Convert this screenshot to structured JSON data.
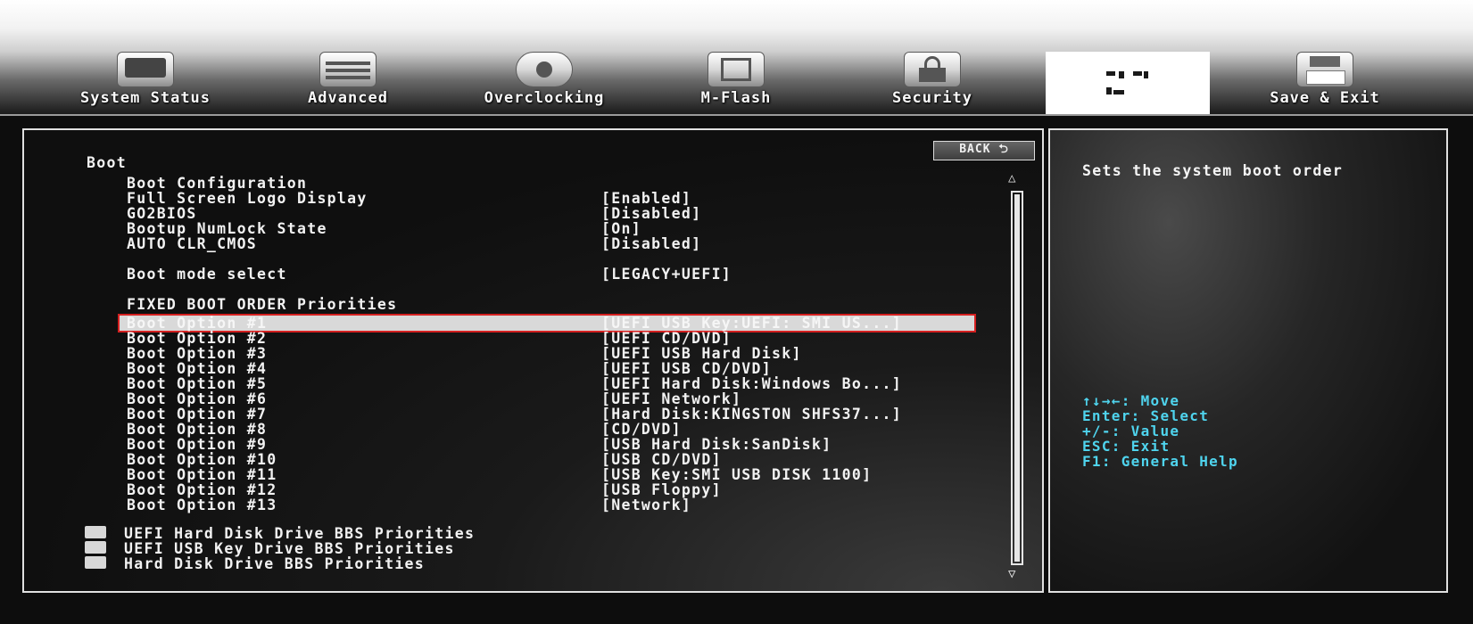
{
  "tabs": [
    {
      "label": "System Status",
      "icon": "monitor-icon"
    },
    {
      "label": "Advanced",
      "icon": "keyboard-icon"
    },
    {
      "label": "Overclocking",
      "icon": "gauge-icon"
    },
    {
      "label": "M-Flash",
      "icon": "usb-drive-icon"
    },
    {
      "label": "Security",
      "icon": "lock-icon"
    },
    {
      "label": "",
      "icon": "boot-icon",
      "active": true
    },
    {
      "label": "Save & Exit",
      "icon": "floppy-icon"
    }
  ],
  "section": {
    "title": "Boot",
    "back_label": "BACK ⮌"
  },
  "settings": [
    {
      "label": "Boot Configuration",
      "value": ""
    },
    {
      "label": "Full Screen Logo Display",
      "value": "[Enabled]"
    },
    {
      "label": "GO2BIOS",
      "value": "[Disabled]"
    },
    {
      "label": "Bootup NumLock State",
      "value": "[On]"
    },
    {
      "label": "AUTO CLR_CMOS",
      "value": "[Disabled]"
    },
    {
      "label": "Boot mode select",
      "value": "[LEGACY+UEFI]"
    },
    {
      "label": "FIXED BOOT ORDER Priorities",
      "value": ""
    }
  ],
  "boot_options": [
    {
      "label": "Boot Option #1",
      "value": "[UEFI USB Key:UEFI: SMI US...]",
      "selected": true
    },
    {
      "label": "Boot Option #2",
      "value": "[UEFI CD/DVD]"
    },
    {
      "label": "Boot Option #3",
      "value": "[UEFI USB Hard Disk]"
    },
    {
      "label": "Boot Option #4",
      "value": "[UEFI USB CD/DVD]"
    },
    {
      "label": "Boot Option #5",
      "value": "[UEFI Hard Disk:Windows Bo...]"
    },
    {
      "label": "Boot Option #6",
      "value": "[UEFI Network]"
    },
    {
      "label": "Boot Option #7",
      "value": "[Hard Disk:KINGSTON SHFS37...]"
    },
    {
      "label": "Boot Option #8",
      "value": "[CD/DVD]"
    },
    {
      "label": "Boot Option #9",
      "value": "[USB Hard Disk:SanDisk]"
    },
    {
      "label": "Boot Option #10",
      "value": "[USB CD/DVD]"
    },
    {
      "label": "Boot Option #11",
      "value": "[USB Key:SMI USB DISK 1100]"
    },
    {
      "label": "Boot Option #12",
      "value": "[USB Floppy]"
    },
    {
      "label": "Boot Option #13",
      "value": "[Network]"
    }
  ],
  "submenus": [
    {
      "label": "UEFI Hard Disk Drive BBS Priorities"
    },
    {
      "label": "UEFI USB Key Drive BBS Priorities"
    },
    {
      "label": "Hard Disk Drive BBS Priorities"
    }
  ],
  "help": {
    "description": "Sets the system boot order",
    "keys": [
      "↑↓→←: Move",
      "Enter: Select",
      "+/-: Value",
      "ESC: Exit",
      "F1: General Help"
    ]
  },
  "colors": {
    "highlight": "#d9d9d9",
    "selection_border": "#d42020",
    "help_keys": "#4fd4ee"
  }
}
